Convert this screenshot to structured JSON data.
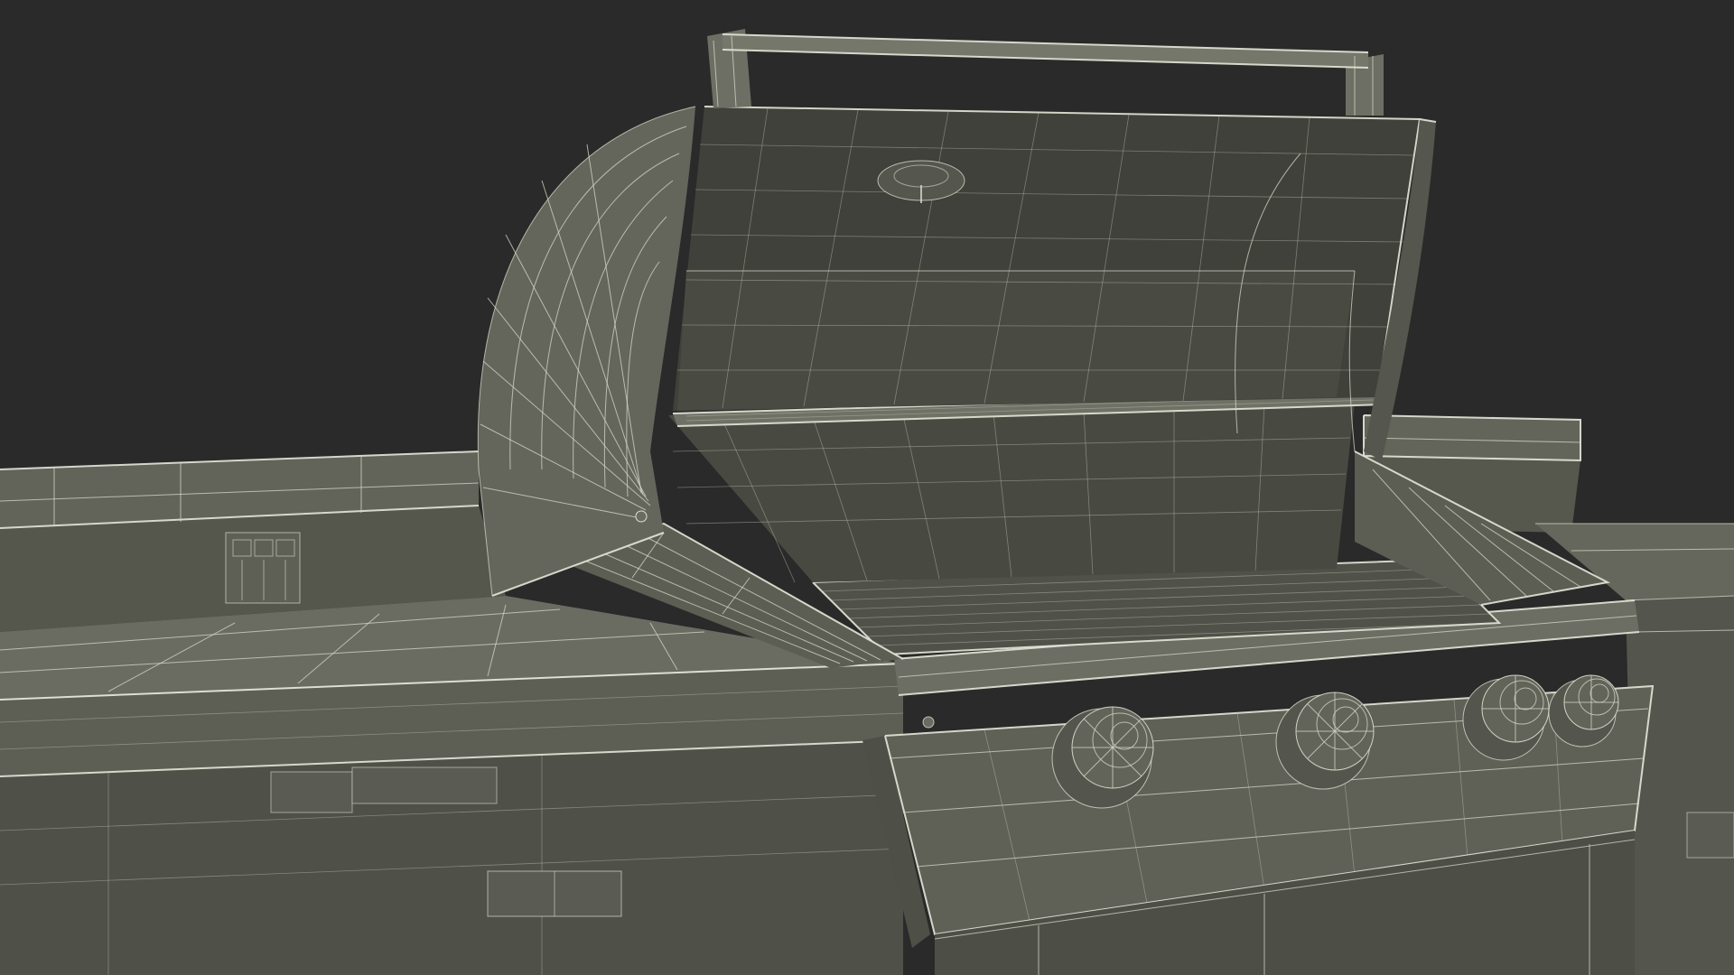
{
  "scene": {
    "subject": "",
    "colors": {
      "background": "#2a2a2a",
      "body_fill": "#5b5d52",
      "body_fill_dark": "#4a4c43",
      "body_fill_light": "#6a6c60",
      "lid_inner": "#3e403a",
      "wire": "#d8d8c8"
    },
    "knobs": [
      {
        "id": "knob-1"
      },
      {
        "id": "knob-2"
      },
      {
        "id": "knob-3"
      },
      {
        "id": "knob-4"
      }
    ]
  }
}
